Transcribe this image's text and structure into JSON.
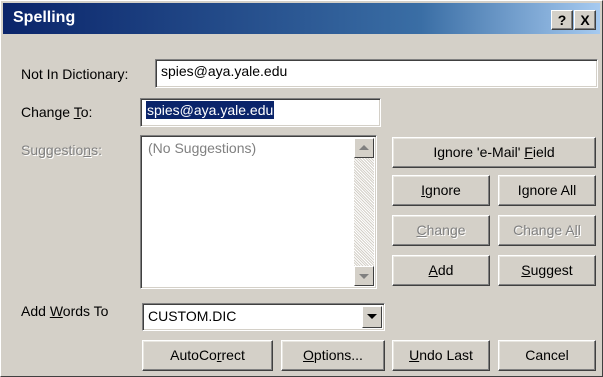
{
  "window": {
    "title": "Spelling",
    "help_button": "?",
    "close_button": "X"
  },
  "not_in_dictionary": {
    "label": "Not In Dictionary:",
    "value": "spies@aya.yale.edu"
  },
  "change_to": {
    "label_pre": "Change ",
    "label_key": "T",
    "label_post": "o:",
    "value": "spies@aya.yale.edu"
  },
  "suggestions": {
    "label_pre": "Suggestio",
    "label_key": "n",
    "label_post": "s:",
    "placeholder": "(No Suggestions)"
  },
  "add_words_to": {
    "label_pre": "Add ",
    "label_key": "W",
    "label_post": "ords To",
    "value": "CUSTOM.DIC"
  },
  "buttons": {
    "ignore_email": {
      "pre": "Ignore 'e-Mail' ",
      "key": "F",
      "post": "ield"
    },
    "ignore": {
      "pre": "",
      "key": "I",
      "post": "gnore"
    },
    "ignore_all": {
      "pre": "I",
      "key": "g",
      "post": "nore All"
    },
    "change": {
      "pre": "",
      "key": "C",
      "post": "hange"
    },
    "change_all": {
      "pre": "Change A",
      "key": "l",
      "post": "l"
    },
    "add": {
      "pre": "",
      "key": "A",
      "post": "dd"
    },
    "suggest": {
      "pre": "",
      "key": "S",
      "post": "uggest"
    },
    "autocorrect": {
      "pre": "AutoCo",
      "key": "r",
      "post": "rect"
    },
    "options": {
      "pre": "",
      "key": "O",
      "post": "ptions..."
    },
    "undo_last": {
      "pre": "",
      "key": "U",
      "post": "ndo Last"
    },
    "cancel": {
      "pre": "Cancel",
      "key": "",
      "post": ""
    }
  },
  "colors": {
    "title_bar": "#0a246a",
    "dialog_face": "#d4d0c8",
    "selection": "#0a246a",
    "disabled_text": "#808080"
  }
}
